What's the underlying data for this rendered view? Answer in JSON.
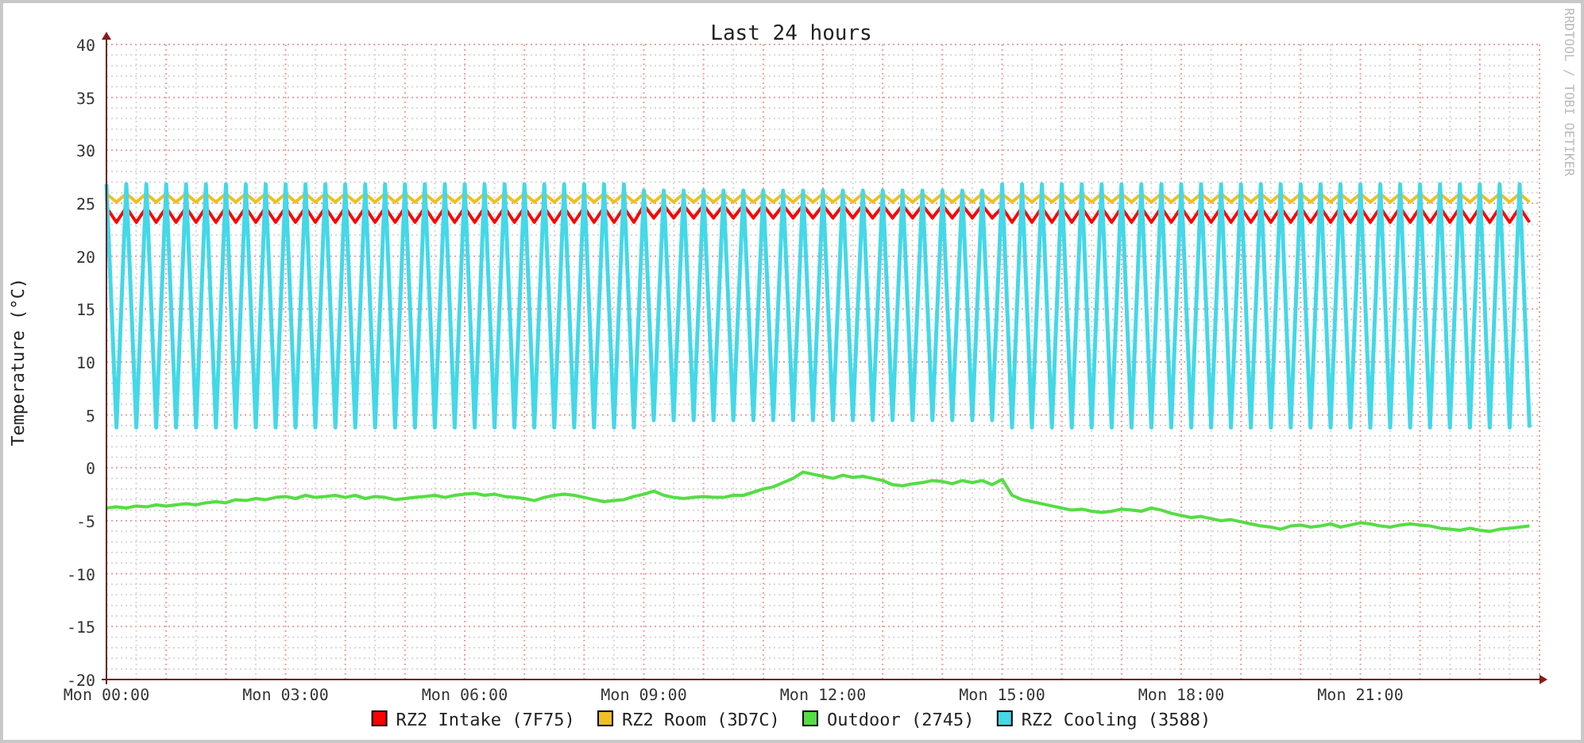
{
  "chart": {
    "credit": "RRDTOOL / TOBI OETIKER",
    "chart_data": {
      "type": "line",
      "title": "Last 24 hours",
      "ylabel": "Temperature (°C)",
      "ylim": [
        -20,
        40
      ],
      "grid": true,
      "legend": "bottom",
      "yticks": [
        -20,
        -15,
        -10,
        -5,
        0,
        5,
        10,
        15,
        20,
        25,
        30,
        35,
        40
      ],
      "categories": [
        "Mon 00:00",
        null,
        null,
        null,
        null,
        null,
        null,
        null,
        null,
        null,
        null,
        null,
        null,
        null,
        null,
        null,
        null,
        null,
        "Mon 03:00",
        null,
        null,
        null,
        null,
        null,
        null,
        null,
        null,
        null,
        null,
        null,
        null,
        null,
        null,
        null,
        null,
        null,
        "Mon 06:00",
        null,
        null,
        null,
        null,
        null,
        null,
        null,
        null,
        null,
        null,
        null,
        null,
        null,
        null,
        null,
        null,
        null,
        "Mon 09:00",
        null,
        null,
        null,
        null,
        null,
        null,
        null,
        null,
        null,
        null,
        null,
        null,
        null,
        null,
        null,
        null,
        null,
        "Mon 12:00",
        null,
        null,
        null,
        null,
        null,
        null,
        null,
        null,
        null,
        null,
        null,
        null,
        null,
        null,
        null,
        null,
        null,
        "Mon 15:00",
        null,
        null,
        null,
        null,
        null,
        null,
        null,
        null,
        null,
        null,
        null,
        null,
        null,
        null,
        null,
        null,
        null,
        "Mon 18:00",
        null,
        null,
        null,
        null,
        null,
        null,
        null,
        null,
        null,
        null,
        null,
        null,
        null,
        null,
        null,
        null,
        null,
        "Mon 21:00",
        null,
        null,
        null,
        null,
        null,
        null,
        null,
        null,
        null,
        null,
        null,
        null,
        null,
        null,
        null,
        null,
        null
      ],
      "series": [
        {
          "name": "RZ2 Intake (7F75)",
          "color": "#ff0000",
          "values": [
            24.6,
            23.2,
            24.6,
            23.2,
            24.6,
            23.2,
            24.6,
            23.2,
            24.6,
            23.2,
            24.6,
            23.2,
            24.6,
            23.2,
            24.6,
            23.2,
            24.6,
            23.2,
            24.6,
            23.2,
            24.6,
            23.2,
            24.6,
            23.2,
            24.6,
            23.2,
            24.6,
            23.2,
            24.6,
            23.2,
            24.6,
            23.2,
            24.6,
            23.2,
            24.6,
            23.2,
            24.6,
            23.2,
            24.6,
            23.2,
            24.6,
            23.2,
            24.6,
            23.2,
            24.6,
            23.2,
            24.6,
            23.2,
            24.6,
            23.2,
            24.6,
            23.2,
            24.6,
            23.2,
            24.8,
            23.6,
            24.8,
            23.6,
            24.8,
            23.6,
            24.8,
            23.6,
            24.8,
            23.6,
            24.8,
            23.6,
            24.8,
            23.6,
            24.8,
            23.6,
            24.8,
            23.6,
            24.8,
            23.6,
            24.8,
            23.6,
            24.8,
            23.6,
            24.8,
            23.6,
            24.8,
            23.6,
            24.8,
            23.6,
            24.8,
            23.6,
            24.8,
            23.6,
            24.8,
            23.6,
            24.6,
            23.2,
            24.6,
            23.2,
            24.6,
            23.2,
            24.6,
            23.2,
            24.6,
            23.2,
            24.6,
            23.2,
            24.6,
            23.2,
            24.6,
            23.2,
            24.6,
            23.2,
            24.6,
            23.2,
            24.6,
            23.2,
            24.6,
            23.2,
            24.6,
            23.2,
            24.6,
            23.2,
            24.6,
            23.2,
            24.6,
            23.2,
            24.6,
            23.2,
            24.6,
            23.2,
            24.6,
            23.2,
            24.6,
            23.2,
            24.6,
            23.2,
            24.6,
            23.2,
            24.6,
            23.2,
            24.6,
            23.2,
            24.6,
            23.2,
            24.6,
            23.2,
            24.6,
            23.2
          ]
        },
        {
          "name": "RZ2 Room (3D7C)",
          "color": "#eec020",
          "values": [
            25.9,
            25.1,
            25.9,
            25.1,
            25.9,
            25.1,
            25.9,
            25.1,
            25.9,
            25.1,
            25.9,
            25.1,
            25.9,
            25.1,
            25.9,
            25.1,
            25.9,
            25.1,
            25.9,
            25.1,
            25.9,
            25.1,
            25.9,
            25.1,
            25.9,
            25.1,
            25.9,
            25.1,
            25.9,
            25.1,
            25.9,
            25.1,
            25.9,
            25.1,
            25.9,
            25.1,
            25.9,
            25.1,
            25.9,
            25.1,
            25.9,
            25.1,
            25.9,
            25.1,
            25.9,
            25.1,
            25.9,
            25.1,
            25.9,
            25.1,
            25.9,
            25.1,
            25.9,
            25.1,
            25.9,
            25.1,
            25.9,
            25.1,
            25.9,
            25.1,
            25.9,
            25.1,
            25.9,
            25.1,
            25.9,
            25.1,
            25.9,
            25.1,
            25.9,
            25.1,
            25.9,
            25.1,
            25.9,
            25.1,
            25.9,
            25.1,
            25.9,
            25.1,
            25.9,
            25.1,
            25.9,
            25.1,
            25.9,
            25.1,
            25.9,
            25.1,
            25.9,
            25.1,
            25.9,
            25.1,
            25.9,
            25.1,
            25.9,
            25.1,
            25.9,
            25.1,
            25.9,
            25.1,
            25.9,
            25.1,
            25.9,
            25.1,
            25.9,
            25.1,
            25.9,
            25.1,
            25.9,
            25.1,
            25.9,
            25.1,
            25.9,
            25.1,
            25.9,
            25.1,
            25.9,
            25.1,
            25.9,
            25.1,
            25.9,
            25.1,
            25.9,
            25.1,
            25.9,
            25.1,
            25.9,
            25.1,
            25.9,
            25.1,
            25.9,
            25.1,
            25.9,
            25.1,
            25.9,
            25.1,
            25.9,
            25.1,
            25.9,
            25.1,
            25.9,
            25.1,
            25.9,
            25.1,
            25.9,
            25.1
          ]
        },
        {
          "name": "Outdoor (2745)",
          "color": "#55dd44",
          "values": [
            -3.8,
            -3.7,
            -3.8,
            -3.6,
            -3.7,
            -3.5,
            -3.6,
            -3.5,
            -3.4,
            -3.5,
            -3.3,
            -3.2,
            -3.3,
            -3.0,
            -3.1,
            -2.9,
            -3.0,
            -2.8,
            -2.7,
            -2.9,
            -2.6,
            -2.8,
            -2.7,
            -2.6,
            -2.8,
            -2.6,
            -2.9,
            -2.7,
            -2.8,
            -3.0,
            -2.9,
            -2.8,
            -2.7,
            -2.6,
            -2.8,
            -2.6,
            -2.5,
            -2.4,
            -2.6,
            -2.5,
            -2.7,
            -2.8,
            -2.9,
            -3.1,
            -2.8,
            -2.6,
            -2.5,
            -2.6,
            -2.8,
            -3.0,
            -3.2,
            -3.1,
            -3.0,
            -2.7,
            -2.5,
            -2.2,
            -2.6,
            -2.8,
            -2.9,
            -2.8,
            -2.7,
            -2.8,
            -2.8,
            -2.6,
            -2.6,
            -2.3,
            -2.0,
            -1.8,
            -1.4,
            -1.0,
            -0.4,
            -0.6,
            -0.8,
            -1.0,
            -0.7,
            -0.9,
            -0.8,
            -1.0,
            -1.2,
            -1.6,
            -1.7,
            -1.5,
            -1.4,
            -1.2,
            -1.3,
            -1.5,
            -1.2,
            -1.4,
            -1.2,
            -1.6,
            -1.1,
            -2.6,
            -3.0,
            -3.2,
            -3.4,
            -3.6,
            -3.8,
            -4.0,
            -3.9,
            -4.1,
            -4.2,
            -4.1,
            -3.9,
            -4.0,
            -4.1,
            -3.8,
            -4.0,
            -4.3,
            -4.5,
            -4.7,
            -4.6,
            -4.8,
            -5.0,
            -4.9,
            -5.1,
            -5.3,
            -5.5,
            -5.6,
            -5.8,
            -5.5,
            -5.4,
            -5.6,
            -5.5,
            -5.3,
            -5.6,
            -5.4,
            -5.2,
            -5.3,
            -5.5,
            -5.6,
            -5.4,
            -5.3,
            -5.4,
            -5.5,
            -5.7,
            -5.8,
            -5.9,
            -5.7,
            -5.9,
            -6.0,
            -5.8,
            -5.7,
            -5.6,
            -5.5
          ]
        },
        {
          "name": "RZ2 Cooling (3588)",
          "color": "#44d8e8",
          "values": [
            26.8,
            3.8,
            26.8,
            3.8,
            26.8,
            3.8,
            26.8,
            3.8,
            26.8,
            3.8,
            26.8,
            3.8,
            26.8,
            3.8,
            26.8,
            3.8,
            26.8,
            3.8,
            26.8,
            3.8,
            26.8,
            3.8,
            26.8,
            3.8,
            26.8,
            3.8,
            26.8,
            3.8,
            26.8,
            3.8,
            26.8,
            3.8,
            26.8,
            3.8,
            26.8,
            3.8,
            26.8,
            3.8,
            26.8,
            3.8,
            26.8,
            3.8,
            26.8,
            3.8,
            26.8,
            3.8,
            26.8,
            3.8,
            26.8,
            3.8,
            26.8,
            3.8,
            26.8,
            3.8,
            26.2,
            4.5,
            26.2,
            4.5,
            26.2,
            4.5,
            26.2,
            4.5,
            26.2,
            4.5,
            26.2,
            4.5,
            26.2,
            4.5,
            26.2,
            4.5,
            26.2,
            4.5,
            26.2,
            4.5,
            26.2,
            4.5,
            26.2,
            4.5,
            26.2,
            4.5,
            26.2,
            4.5,
            26.2,
            4.5,
            26.2,
            4.5,
            26.2,
            4.5,
            26.2,
            4.5,
            26.8,
            3.8,
            26.8,
            3.8,
            26.8,
            3.8,
            26.8,
            3.8,
            26.8,
            3.8,
            26.8,
            3.8,
            26.8,
            3.8,
            26.8,
            3.8,
            26.8,
            3.8,
            26.8,
            3.8,
            26.8,
            3.8,
            26.8,
            3.8,
            26.8,
            3.8,
            26.8,
            3.8,
            26.8,
            3.8,
            26.8,
            3.8,
            26.8,
            3.8,
            26.8,
            3.8,
            26.8,
            3.8,
            26.8,
            3.8,
            26.8,
            3.8,
            26.8,
            3.8,
            26.8,
            3.8,
            26.8,
            3.8,
            26.8,
            3.8,
            26.8,
            3.8,
            26.8,
            3.8
          ]
        }
      ]
    }
  }
}
